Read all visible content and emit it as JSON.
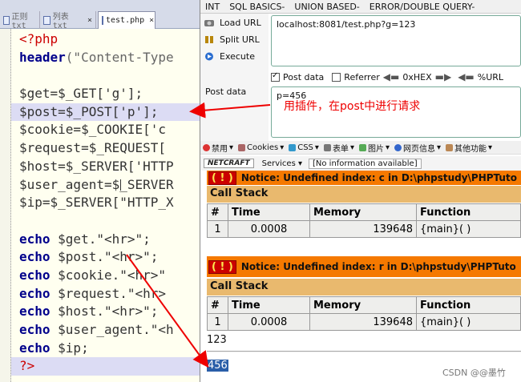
{
  "editor": {
    "tabs": [
      {
        "label": "正则 txt",
        "closable": true
      },
      {
        "label": "列表 txt",
        "closable": true
      },
      {
        "label": "test.php",
        "closable": true
      }
    ],
    "code_lines": [
      {
        "parts": [
          {
            "t": "<?php",
            "c": "tag"
          }
        ],
        "hl": false
      },
      {
        "parts": [
          {
            "t": "header",
            "c": "kw"
          },
          {
            "t": "(\"Content-Type",
            "c": "str"
          }
        ],
        "hl": false
      },
      {
        "parts": [
          {
            "t": "",
            "c": ""
          }
        ],
        "hl": false
      },
      {
        "parts": [
          {
            "t": "$get=$_GET['g'];",
            "c": ""
          }
        ],
        "hl": false
      },
      {
        "parts": [
          {
            "t": "$post=$_POST['p'];",
            "c": ""
          }
        ],
        "hl": true
      },
      {
        "parts": [
          {
            "t": "$cookie=$_COOKIE['c",
            "c": ""
          }
        ],
        "hl": false
      },
      {
        "parts": [
          {
            "t": "$request=$_REQUEST[",
            "c": ""
          }
        ],
        "hl": false
      },
      {
        "parts": [
          {
            "t": "$host=$_SERVER['HTTP",
            "c": ""
          }
        ],
        "hl": false
      },
      {
        "parts": [
          {
            "t": "$user_agent=$_SERVER",
            "c": ""
          }
        ],
        "hl": false
      },
      {
        "parts": [
          {
            "t": "$ip=$_SERVER[\"HTTP_X",
            "c": ""
          }
        ],
        "hl": false
      },
      {
        "parts": [
          {
            "t": "",
            "c": ""
          }
        ],
        "hl": false
      },
      {
        "parts": [
          {
            "t": "echo",
            "c": "kw"
          },
          {
            "t": " $get.\"<hr>\";",
            "c": ""
          }
        ],
        "hl": false
      },
      {
        "parts": [
          {
            "t": "echo",
            "c": "kw"
          },
          {
            "t": " $post.\"<hr>\";",
            "c": ""
          }
        ],
        "hl": false
      },
      {
        "parts": [
          {
            "t": "echo",
            "c": "kw"
          },
          {
            "t": " $cookie.\"<hr>\"",
            "c": ""
          }
        ],
        "hl": false
      },
      {
        "parts": [
          {
            "t": "echo",
            "c": "kw"
          },
          {
            "t": " $request.\"<hr>",
            "c": ""
          }
        ],
        "hl": false
      },
      {
        "parts": [
          {
            "t": "echo",
            "c": "kw"
          },
          {
            "t": " $host.\"<hr>\";",
            "c": ""
          }
        ],
        "hl": false
      },
      {
        "parts": [
          {
            "t": "echo",
            "c": "kw"
          },
          {
            "t": " $user_agent.\"<h",
            "c": ""
          }
        ],
        "hl": false
      },
      {
        "parts": [
          {
            "t": "echo",
            "c": "kw"
          },
          {
            "t": " $ip;",
            "c": ""
          }
        ],
        "hl": false
      },
      {
        "parts": [
          {
            "t": "?>",
            "c": "tag"
          }
        ],
        "hl": true
      }
    ]
  },
  "hackbar": {
    "menu": [
      "INT",
      "SQL BASICS-",
      "UNION BASED-",
      "ERROR/DOUBLE QUERY-"
    ],
    "load_url": "Load URL",
    "split_url": "Split URL",
    "execute": "Execute",
    "url_value": "localhost:8081/test.php?g=123",
    "post_data_label": "Post data",
    "referrer_label": "Referrer",
    "hex_label": "0xHEX",
    "url_label": "%URL",
    "post_label": "Post data",
    "post_value": "p=456",
    "annotation": "用插件，在post中进行请求"
  },
  "toolbar": {
    "items": [
      "禁用",
      "Cookies",
      "CSS",
      "表单",
      "图片",
      "网页信息",
      "其他功能"
    ],
    "netcraft": "NETCRAFT",
    "services": "Services",
    "no_info": "[No information available]"
  },
  "output": {
    "notice_partial": "Notice: Undefined index: c in D:\\phpstudy\\PHPTuto",
    "notice_full": "Notice: Undefined index: r in D:\\phpstudy\\PHPTuto",
    "bang": "( ! )",
    "call_stack": "Call Stack",
    "headers": [
      "#",
      "Time",
      "Memory",
      "Function"
    ],
    "row": [
      "1",
      "0.0008",
      "139648",
      "{main}( )"
    ],
    "get_output": "123",
    "post_output": "456"
  },
  "watermark": "CSDN @@墨竹"
}
